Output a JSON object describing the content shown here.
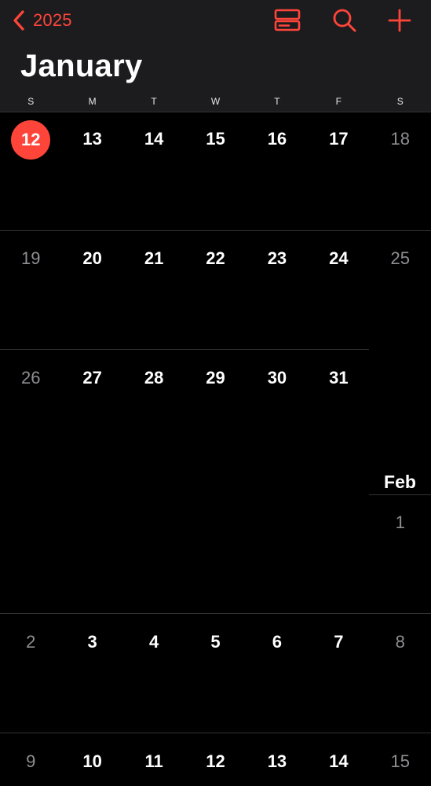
{
  "nav": {
    "back_label": "2025",
    "accent_color": "#ff453a",
    "icons": [
      "chevron-left-icon",
      "list-view-icon",
      "search-icon",
      "plus-icon"
    ]
  },
  "month": {
    "title": "January"
  },
  "weekdays": [
    "S",
    "M",
    "T",
    "W",
    "T",
    "F",
    "S"
  ],
  "weeks": [
    {
      "days": [
        "12",
        "13",
        "14",
        "15",
        "16",
        "17",
        "18"
      ]
    },
    {
      "days": [
        "19",
        "20",
        "21",
        "22",
        "23",
        "24",
        "25"
      ]
    },
    {
      "days": [
        "26",
        "27",
        "28",
        "29",
        "30",
        "31"
      ]
    },
    {
      "days": [
        "1"
      ]
    },
    {
      "days": [
        "2",
        "3",
        "4",
        "5",
        "6",
        "7",
        "8"
      ]
    },
    {
      "days": [
        "9",
        "10",
        "11",
        "12",
        "13",
        "14",
        "15"
      ]
    }
  ],
  "next_month_label": "Feb",
  "today": "12"
}
